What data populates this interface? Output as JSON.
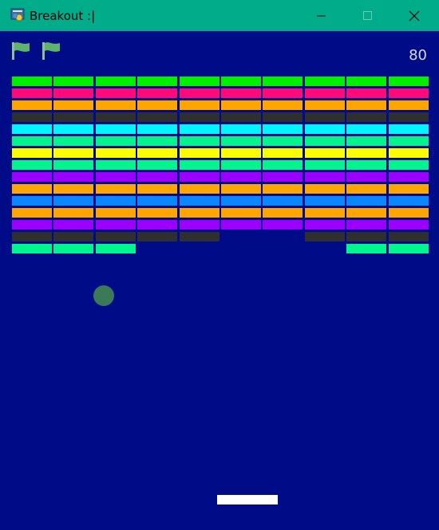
{
  "window": {
    "title": "Breakout :|",
    "titlebar_color": "#00ac8a",
    "controls": [
      "minimize-icon",
      "maximize-icon",
      "close-icon"
    ]
  },
  "game": {
    "background": "#000c87",
    "score": "80",
    "lives_icons": [
      "flag-icon",
      "flag-icon"
    ],
    "ball_color": "#3b7a57",
    "paddle_color": "#ffffff"
  },
  "bricks": {
    "columns": 10,
    "rows": [
      {
        "color": "#00f000",
        "present": [
          1,
          1,
          1,
          1,
          1,
          1,
          1,
          1,
          1,
          1
        ]
      },
      {
        "color": "#ff0a78",
        "present": [
          1,
          1,
          1,
          1,
          1,
          1,
          1,
          1,
          1,
          1
        ]
      },
      {
        "color": "#ffa500",
        "present": [
          1,
          1,
          1,
          1,
          1,
          1,
          1,
          1,
          1,
          1
        ]
      },
      {
        "color": "#2f2f2f",
        "present": [
          1,
          1,
          1,
          1,
          1,
          1,
          1,
          1,
          1,
          1
        ]
      },
      {
        "color": "#00f5ff",
        "present": [
          1,
          1,
          1,
          1,
          1,
          1,
          1,
          1,
          1,
          1
        ]
      },
      {
        "color": "#00f58c",
        "present": [
          1,
          1,
          1,
          1,
          1,
          1,
          1,
          1,
          1,
          1
        ]
      },
      {
        "color": "#ffff00",
        "present": [
          1,
          1,
          1,
          1,
          1,
          1,
          1,
          1,
          1,
          1
        ]
      },
      {
        "color": "#00f58c",
        "present": [
          1,
          1,
          1,
          1,
          1,
          1,
          1,
          1,
          1,
          1
        ]
      },
      {
        "color": "#9b00ff",
        "present": [
          1,
          1,
          1,
          1,
          1,
          1,
          1,
          1,
          1,
          1
        ]
      },
      {
        "color": "#ffa500",
        "present": [
          1,
          1,
          1,
          1,
          1,
          1,
          1,
          1,
          1,
          1
        ]
      },
      {
        "color": "#0a87ff",
        "present": [
          1,
          1,
          1,
          1,
          1,
          1,
          1,
          1,
          1,
          1
        ]
      },
      {
        "color": "#ffa500",
        "present": [
          1,
          1,
          1,
          1,
          1,
          1,
          1,
          1,
          1,
          1
        ]
      },
      {
        "color": "#9b00ff",
        "present": [
          1,
          1,
          1,
          1,
          1,
          1,
          1,
          1,
          1,
          1
        ]
      },
      {
        "color": "#2f2f2f",
        "present": [
          1,
          1,
          1,
          1,
          1,
          0,
          0,
          1,
          1,
          1
        ]
      },
      {
        "color": "#00f58c",
        "present": [
          1,
          1,
          1,
          0,
          0,
          0,
          0,
          0,
          1,
          1
        ]
      }
    ]
  }
}
